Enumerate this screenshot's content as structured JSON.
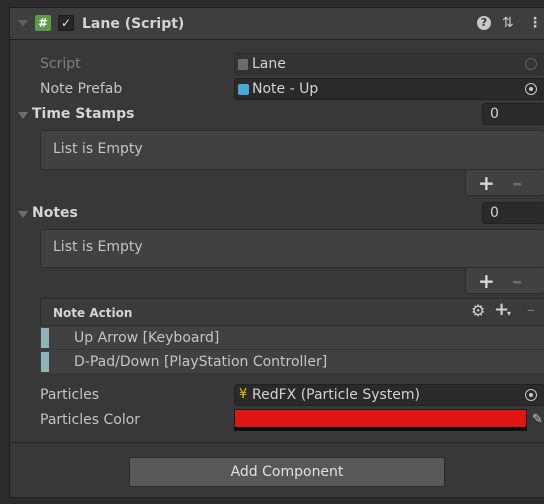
{
  "component": {
    "title": "Lane (Script)",
    "script_label": "Script",
    "script_value": "Lane",
    "note_prefab_label": "Note Prefab",
    "note_prefab_value": "Note - Up",
    "time_stamps": {
      "label": "Time Stamps",
      "count": "0",
      "empty_text": "List is Empty"
    },
    "notes": {
      "label": "Notes",
      "count": "0",
      "empty_text": "List is Empty"
    },
    "note_action": {
      "header": "Note Action",
      "bindings": [
        "Up Arrow [Keyboard]",
        "D-Pad/Down [PlayStation Controller]"
      ]
    },
    "particles_label": "Particles",
    "particles_value": "RedFX (Particle System)",
    "particles_color_label": "Particles Color",
    "particles_color": "#E01515"
  },
  "add_component_label": "Add Component"
}
